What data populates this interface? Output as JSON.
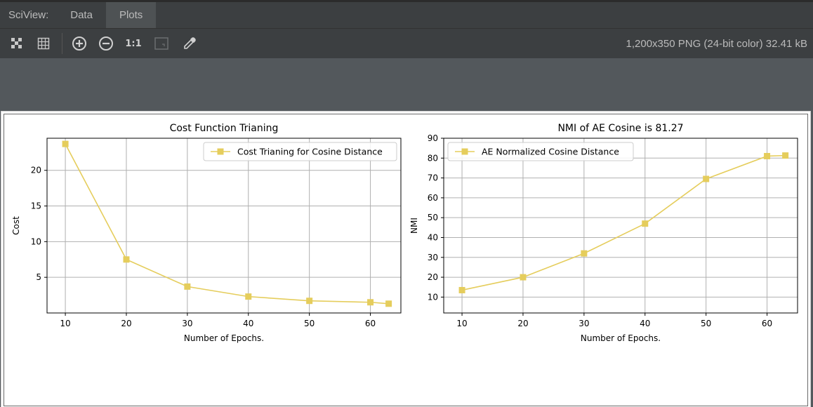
{
  "app": {
    "name": "SciView:"
  },
  "tabs": [
    {
      "label": "Data"
    },
    {
      "label": "Plots"
    }
  ],
  "toolbar": {
    "buttons": [
      "checkerboard-icon",
      "grid-icon",
      "zoom-in-icon",
      "zoom-out-icon",
      "actual-size-icon",
      "fit-icon",
      "color-picker-icon"
    ],
    "actual_size_label": "1:1"
  },
  "image_info": "1,200x350 PNG (24-bit color) 32.41 kB",
  "colors": {
    "series": "#e5cd5c",
    "grid": "#b0b0b0"
  },
  "chart_data": [
    {
      "type": "line",
      "title": "Cost Function Trianing",
      "xlabel": "Number of Epochs.",
      "ylabel": "Cost",
      "xlim": [
        7,
        65
      ],
      "ylim": [
        0,
        24.5
      ],
      "xticks": [
        10,
        20,
        30,
        40,
        50,
        60
      ],
      "yticks": [
        5,
        10,
        15,
        20
      ],
      "grid": true,
      "legend_position": "top-right",
      "series": [
        {
          "name": "Cost Trianing for Cosine Distance",
          "x": [
            10,
            20,
            30,
            40,
            50,
            60,
            63
          ],
          "y": [
            23.7,
            7.5,
            3.7,
            2.3,
            1.7,
            1.5,
            1.3
          ]
        }
      ]
    },
    {
      "type": "line",
      "title": "NMI of AE Cosine is 81.27",
      "xlabel": "Number of Epochs.",
      "ylabel": "NMI",
      "xlim": [
        7,
        65
      ],
      "ylim": [
        2,
        90
      ],
      "xticks": [
        10,
        20,
        30,
        40,
        50,
        60
      ],
      "yticks": [
        10,
        20,
        30,
        40,
        50,
        60,
        70,
        80,
        90
      ],
      "grid": true,
      "legend_position": "top-left",
      "series": [
        {
          "name": "AE Normalized Cosine Distance",
          "x": [
            10,
            20,
            30,
            40,
            50,
            60,
            63
          ],
          "y": [
            13.5,
            20,
            32,
            47,
            69.5,
            81,
            81.3
          ]
        }
      ]
    }
  ]
}
